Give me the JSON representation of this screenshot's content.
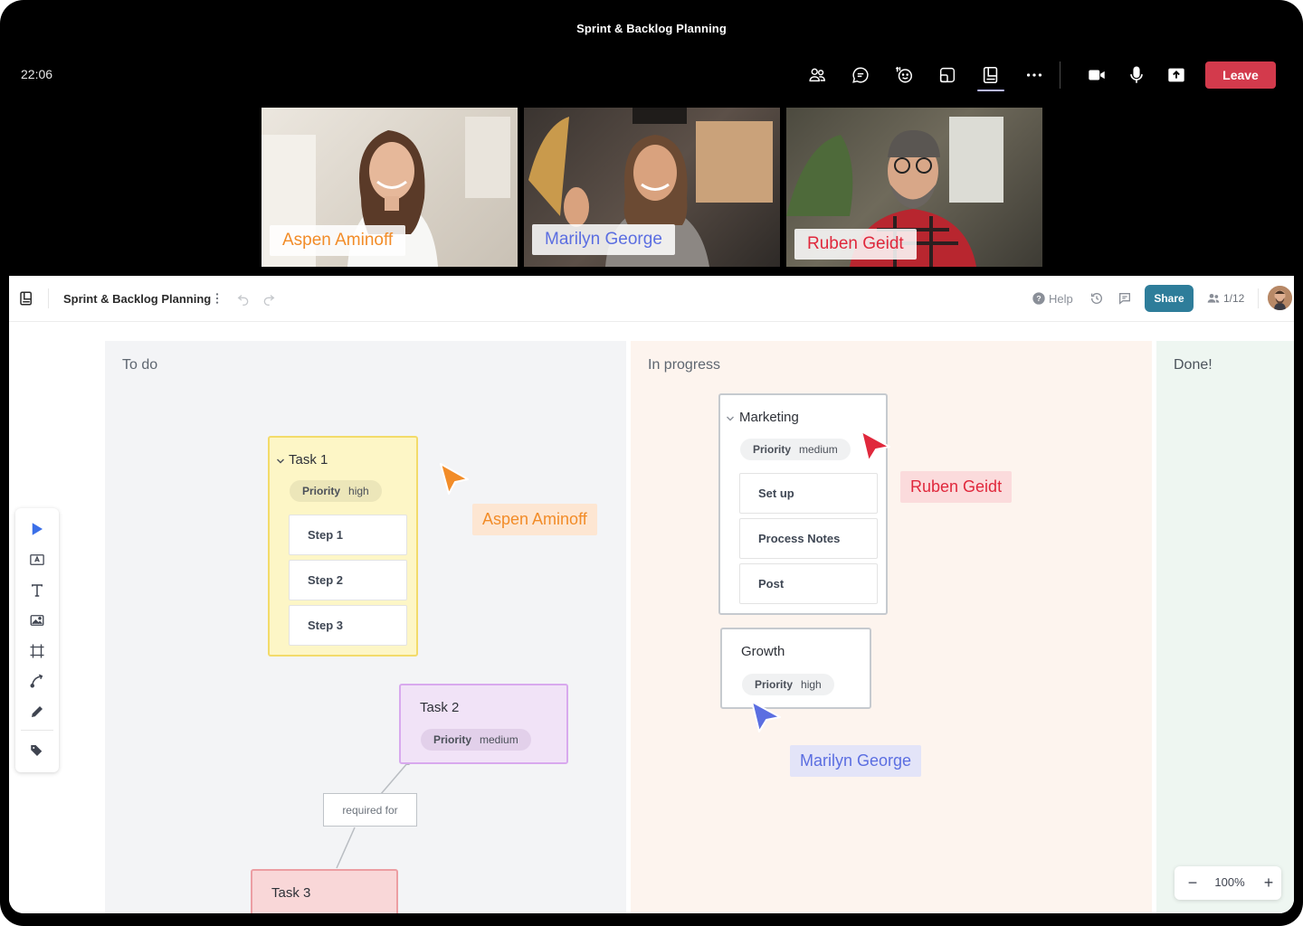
{
  "meeting": {
    "title": "Sprint & Backlog Planning",
    "time": "22:06",
    "toolbar_icons": [
      "people-icon",
      "chat-icon",
      "reactions-icon",
      "rooms-icon",
      "whiteboard-icon",
      "more-icon",
      "camera-icon",
      "microphone-icon",
      "share-screen-icon"
    ],
    "leave_label": "Leave",
    "leave_color": "#d33a4c"
  },
  "participants": [
    {
      "name": "Aspen Aminoff",
      "color": "#f28c28"
    },
    {
      "name": "Marilyn George",
      "color": "#5b6ee1"
    },
    {
      "name": "Ruben Geidt",
      "color": "#e0283c"
    }
  ],
  "whiteboard": {
    "board_name": "Sprint & Backlog Planning",
    "help_label": "Help",
    "share_label": "Share",
    "share_color": "#2e7d9a",
    "collaborators": "1/12",
    "zoom": "100%",
    "tools": [
      "select-arrow-icon",
      "text-box-icon",
      "text-icon",
      "image-icon",
      "frame-icon",
      "connector-icon",
      "pen-icon",
      "tag-icon"
    ]
  },
  "columns": [
    {
      "title": "To do",
      "bg": "#f3f4f6"
    },
    {
      "title": "In progress",
      "bg": "#fdf4ee"
    },
    {
      "title": "Done!",
      "bg": "#eef6f1"
    }
  ],
  "cards": {
    "task1": {
      "title": "Task 1",
      "priority_key": "Priority",
      "priority_value": "high",
      "steps": [
        "Step 1",
        "Step 2",
        "Step 3"
      ]
    },
    "task2": {
      "title": "Task 2",
      "priority_key": "Priority",
      "priority_value": "medium"
    },
    "task3": {
      "title": "Task 3"
    },
    "marketing": {
      "title": "Marketing",
      "priority_key": "Priority",
      "priority_value": "medium",
      "steps": [
        "Set up",
        "Process Notes",
        "Post"
      ]
    },
    "growth": {
      "title": "Growth",
      "priority_key": "Priority",
      "priority_value": "high"
    }
  },
  "relation_label": "required for",
  "cursors": {
    "aspen": "Aspen Aminoff",
    "ruben": "Ruben Geidt",
    "marilyn": "Marilyn George"
  }
}
